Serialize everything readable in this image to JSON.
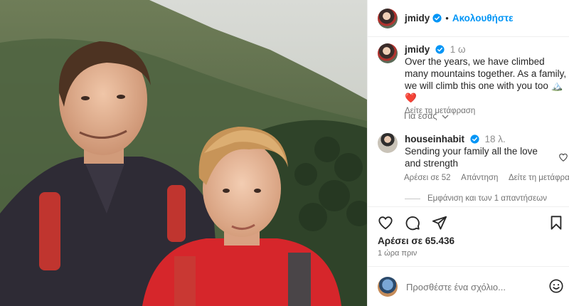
{
  "post": {
    "username": "jmidy",
    "follow_label": "Ακολουθήστε",
    "dot": "•",
    "caption": {
      "username": "jmidy",
      "time": "1 ω",
      "text": "Over the years, we have climbed many mountains together. As a family, we will climb this one with you too",
      "emoji": "🏔️❤️",
      "translate_label": "Δείτε τη μετάφραση"
    },
    "for_you_label": "Για εσάς",
    "comment": {
      "username": "houseinhabit",
      "time": "18 λ.",
      "text": "Sending your family all the love and strength",
      "likes_label": "Αρέσει σε 52",
      "reply_label": "Απάντηση",
      "translate_label": "Δείτε τη μετάφραση",
      "view_replies_label": "Εμφάνιση και των 1 απαντήσεων"
    },
    "likes_label": "Αρέσει σε 65.436",
    "posted_ago": "1 ώρα πριν",
    "add_comment_placeholder": "Προσθέστε ένα σχόλιο..."
  },
  "colors": {
    "accent": "#0095f6",
    "verified": "#0095f6",
    "muted": "#737373"
  },
  "icons": [
    "verified-badge-icon",
    "heart-icon",
    "comment-icon",
    "share-icon",
    "bookmark-icon",
    "smiley-icon",
    "chevron-down-icon"
  ]
}
